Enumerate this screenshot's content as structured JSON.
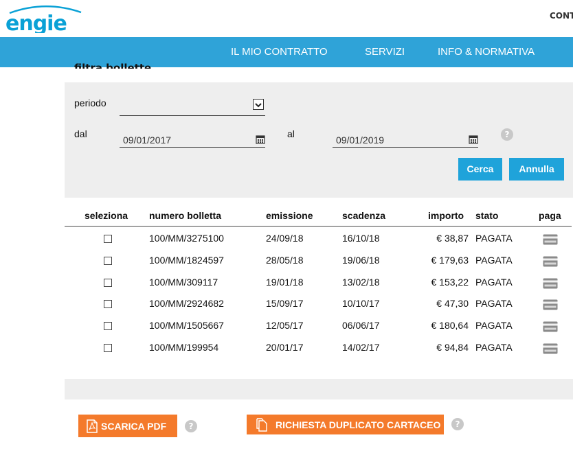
{
  "header": {
    "logo_text": "ENGIE",
    "top_right_text": "CONT",
    "brand_color": "#0aa1d6"
  },
  "nav": {
    "items": [
      {
        "label": "IL MIO CONTRATTO"
      },
      {
        "label": "SERVIZI"
      },
      {
        "label": "INFO & NORMATIVA"
      }
    ],
    "bg_color": "#2fa3d8"
  },
  "filter": {
    "title": "filtra bollette",
    "period_label": "periodo",
    "period_value": "",
    "from_label": "dal",
    "from_value": "09/01/2017",
    "to_label": "al",
    "to_value": "09/01/2019",
    "help_glyph": "?",
    "search_label": "Cerca",
    "cancel_label": "Annulla"
  },
  "table": {
    "headers": {
      "select": "seleziona",
      "number": "numero bolletta",
      "issue": "emissione",
      "due": "scadenza",
      "amount": "importo",
      "status": "stato",
      "pay": "paga"
    },
    "rows": [
      {
        "number": "100/MM/3275100",
        "issue": "24/09/18",
        "due": "16/10/18",
        "amount": "€ 38,87",
        "status": "PAGATA"
      },
      {
        "number": "100/MM/1824597",
        "issue": "28/05/18",
        "due": "19/06/18",
        "amount": "€ 179,63",
        "status": "PAGATA"
      },
      {
        "number": "100/MM/309117",
        "issue": "19/01/18",
        "due": "13/02/18",
        "amount": "€ 153,22",
        "status": "PAGATA"
      },
      {
        "number": "100/MM/2924682",
        "issue": "15/09/17",
        "due": "10/10/17",
        "amount": "€ 47,30",
        "status": "PAGATA"
      },
      {
        "number": "100/MM/1505667",
        "issue": "12/05/17",
        "due": "06/06/17",
        "amount": "€ 180,64",
        "status": "PAGATA"
      },
      {
        "number": "100/MM/199954",
        "issue": "20/01/17",
        "due": "14/02/17",
        "amount": "€ 94,84",
        "status": "PAGATA"
      }
    ]
  },
  "actions": {
    "pdf_label": "SCARICA PDF",
    "duplicate_label": "RICHIESTA DUPLICATO CARTACEO",
    "accent_color": "#f47a2b"
  }
}
